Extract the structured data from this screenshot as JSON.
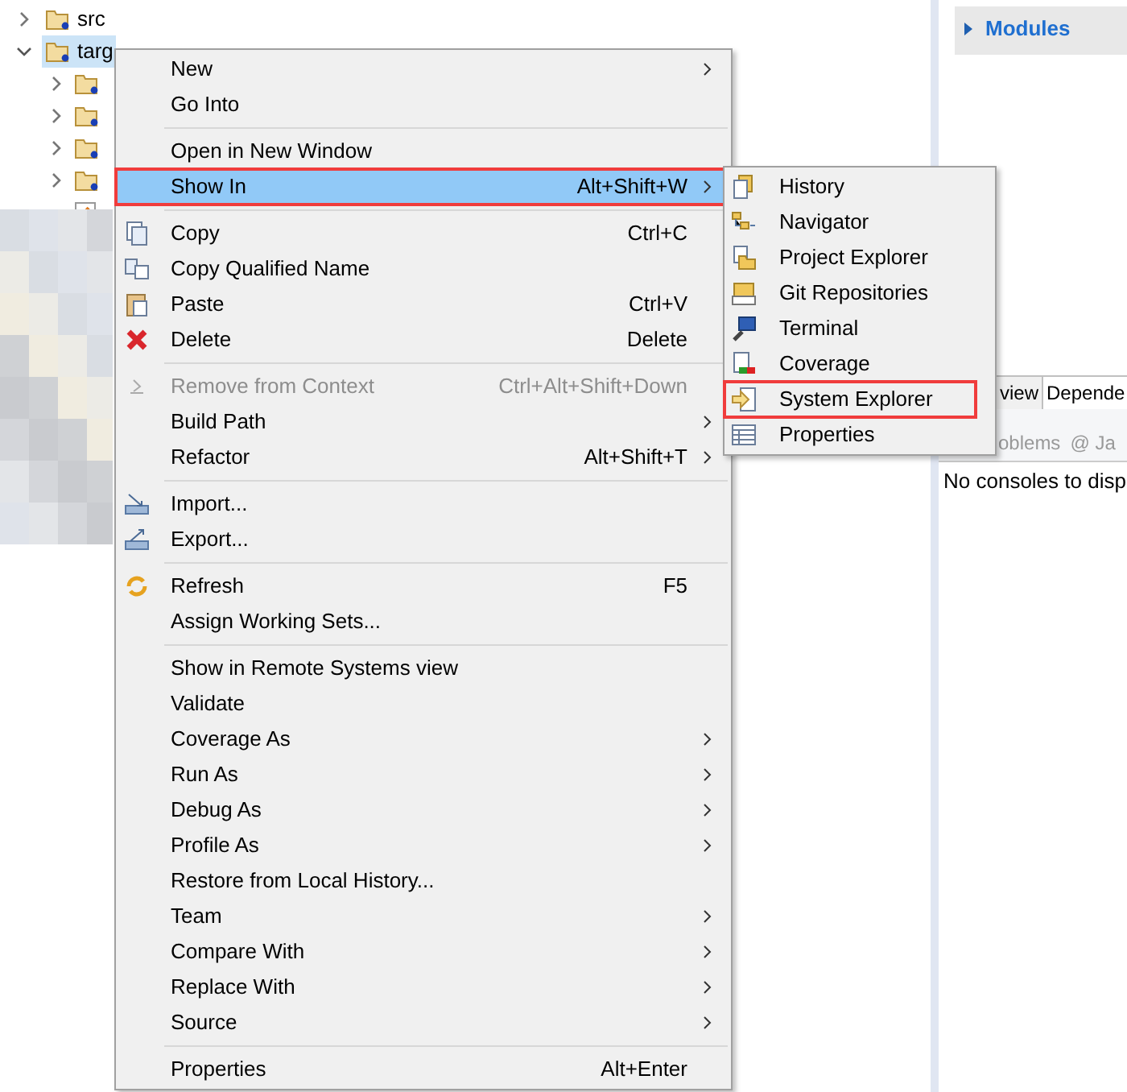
{
  "tree": [
    {
      "label": "src",
      "expanded": false,
      "selected": false
    },
    {
      "label": "targ",
      "expanded": true,
      "selected": true,
      "children": [
        {
          "kind": "folder"
        },
        {
          "kind": "folder"
        },
        {
          "kind": "folder"
        },
        {
          "kind": "folder"
        },
        {
          "kind": "file"
        }
      ]
    }
  ],
  "right_panel": {
    "section": "Modules",
    "tabs": [
      {
        "label": "view",
        "selected": false
      },
      {
        "label": "Depende",
        "selected": true
      }
    ],
    "view_tabs": [
      "oblems",
      "@ Ja"
    ],
    "console_text": "No consoles to disp"
  },
  "context_menu": [
    {
      "kind": "item",
      "label": "New",
      "submenu": true
    },
    {
      "kind": "item",
      "label": "Go Into"
    },
    {
      "kind": "separator"
    },
    {
      "kind": "item",
      "label": "Open in New Window"
    },
    {
      "kind": "item",
      "label": "Show In",
      "shortcut": "Alt+Shift+W",
      "submenu": true,
      "selected": true,
      "highlighted": true
    },
    {
      "kind": "separator"
    },
    {
      "kind": "item",
      "label": "Copy",
      "shortcut": "Ctrl+C"
    },
    {
      "kind": "item",
      "label": "Copy Qualified Name"
    },
    {
      "kind": "item",
      "label": "Paste",
      "shortcut": "Ctrl+V"
    },
    {
      "kind": "item",
      "label": "Delete",
      "shortcut": "Delete"
    },
    {
      "kind": "separator"
    },
    {
      "kind": "item",
      "label": "Remove from Context",
      "shortcut": "Ctrl+Alt+Shift+Down",
      "disabled": true
    },
    {
      "kind": "item",
      "label": "Build Path",
      "submenu": true
    },
    {
      "kind": "item",
      "label": "Refactor",
      "shortcut": "Alt+Shift+T",
      "submenu": true
    },
    {
      "kind": "separator"
    },
    {
      "kind": "item",
      "label": "Import..."
    },
    {
      "kind": "item",
      "label": "Export..."
    },
    {
      "kind": "separator"
    },
    {
      "kind": "item",
      "label": "Refresh",
      "shortcut": "F5"
    },
    {
      "kind": "item",
      "label": "Assign Working Sets..."
    },
    {
      "kind": "separator"
    },
    {
      "kind": "item",
      "label": "Show in Remote Systems view"
    },
    {
      "kind": "item",
      "label": "Validate"
    },
    {
      "kind": "item",
      "label": "Coverage As",
      "submenu": true
    },
    {
      "kind": "item",
      "label": "Run As",
      "submenu": true
    },
    {
      "kind": "item",
      "label": "Debug As",
      "submenu": true
    },
    {
      "kind": "item",
      "label": "Profile As",
      "submenu": true
    },
    {
      "kind": "item",
      "label": "Restore from Local History..."
    },
    {
      "kind": "item",
      "label": "Team",
      "submenu": true
    },
    {
      "kind": "item",
      "label": "Compare With",
      "submenu": true
    },
    {
      "kind": "item",
      "label": "Replace With",
      "submenu": true
    },
    {
      "kind": "item",
      "label": "Source",
      "submenu": true
    },
    {
      "kind": "separator"
    },
    {
      "kind": "item",
      "label": "Properties",
      "shortcut": "Alt+Enter"
    }
  ],
  "submenu": [
    {
      "label": "History",
      "highlighted": false
    },
    {
      "label": "Navigator",
      "highlighted": false
    },
    {
      "label": "Project Explorer",
      "highlighted": false
    },
    {
      "label": "Git Repositories",
      "highlighted": false
    },
    {
      "label": "Terminal",
      "highlighted": false
    },
    {
      "label": "Coverage",
      "highlighted": false
    },
    {
      "label": "System Explorer",
      "highlighted": true
    },
    {
      "label": "Properties",
      "highlighted": false
    }
  ]
}
